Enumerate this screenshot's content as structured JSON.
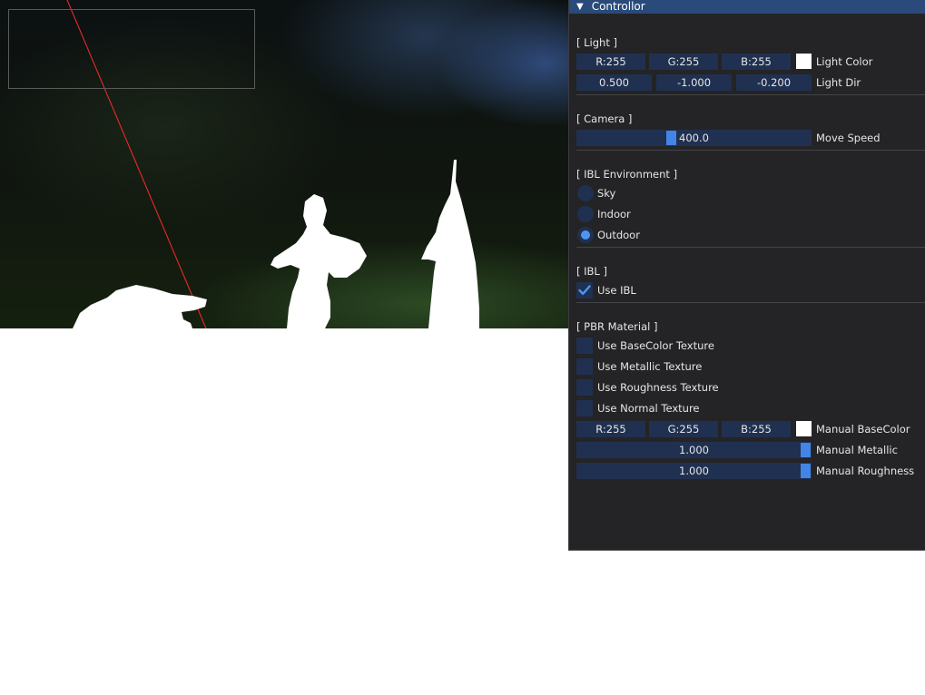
{
  "window": {
    "title": "Controllor"
  },
  "light": {
    "section": "[ Light ]",
    "color": {
      "r": "R:255",
      "g": "G:255",
      "b": "B:255",
      "swatch": "#ffffff",
      "label": "Light Color"
    },
    "dir": {
      "x": "0.500",
      "y": "-1.000",
      "z": "-0.200",
      "label": "Light Dir"
    }
  },
  "camera": {
    "section": "[ Camera ]",
    "move_speed": "400.0",
    "move_speed_fraction": 0.4,
    "label": "Move Speed"
  },
  "ibl_env": {
    "section": "[ IBL Environment ]",
    "options": [
      {
        "label": "Sky",
        "selected": false
      },
      {
        "label": "Indoor",
        "selected": false
      },
      {
        "label": "Outdoor",
        "selected": true
      }
    ]
  },
  "ibl": {
    "section": "[ IBL ]",
    "use_ibl": {
      "label": "Use IBL",
      "checked": true
    }
  },
  "pbr": {
    "section": "[ PBR Material ]",
    "checkboxes": [
      {
        "label": "Use BaseColor Texture",
        "checked": false
      },
      {
        "label": "Use Metallic Texture",
        "checked": false
      },
      {
        "label": "Use Roughness Texture",
        "checked": false
      },
      {
        "label": "Use Normal Texture",
        "checked": false
      }
    ],
    "base_color": {
      "r": "R:255",
      "g": "G:255",
      "b": "B:255",
      "swatch": "#ffffff",
      "label": "Manual BaseColor"
    },
    "metallic": {
      "value": "1.000",
      "fraction": 1.0,
      "label": "Manual Metallic"
    },
    "roughness": {
      "value": "1.000",
      "fraction": 1.0,
      "label": "Manual Roughness"
    }
  },
  "colors": {
    "accent": "#4285e6",
    "field_bg": "#203050",
    "title_bar": "#294a7a",
    "debug_line": "#ff0000"
  }
}
